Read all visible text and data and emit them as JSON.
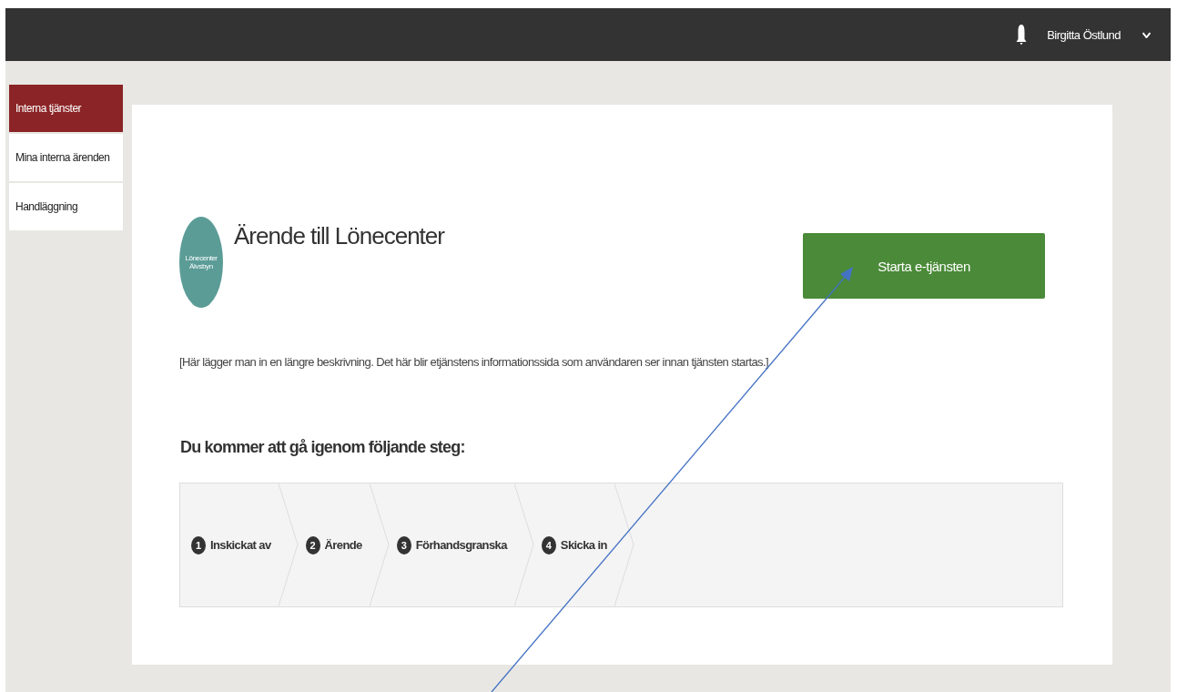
{
  "header": {
    "user_name": "Birgitta Östlund"
  },
  "sidebar": {
    "items": [
      {
        "label": "Interna tjänster",
        "selected": true
      },
      {
        "label": "Mina interna ärenden",
        "selected": false
      },
      {
        "label": "Handläggning",
        "selected": false
      }
    ]
  },
  "service": {
    "logo": {
      "name": "Lönecenter",
      "place": "Älvsbyn"
    },
    "title": "Ärende till Lönecenter",
    "start_button": "Starta e-tjänsten",
    "description": "[Här lägger man in en längre beskrivning. Det här blir etjänstens informationssida som användaren ser innan tjänsten startas.]"
  },
  "steps": {
    "heading": "Du kommer att gå igenom följande steg:",
    "items": [
      {
        "number": "1",
        "label": "Inskickat av"
      },
      {
        "number": "2",
        "label": "Ärende"
      },
      {
        "number": "3",
        "label": "Förhandsgranska"
      },
      {
        "number": "4",
        "label": "Skicka in"
      }
    ]
  }
}
